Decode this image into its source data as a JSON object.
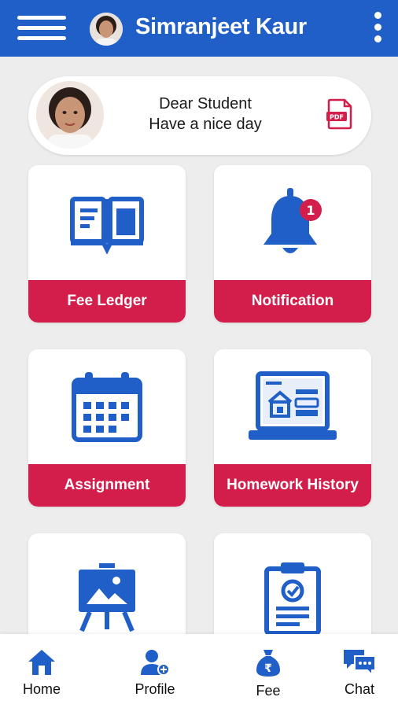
{
  "header": {
    "user_name": "Simranjeet Kaur",
    "menu_icon": "hamburger-menu-icon",
    "more_icon": "kebab-menu-icon"
  },
  "greeting": {
    "line1": "Dear Student",
    "line2": "Have a nice day",
    "pdf_label": "PDF"
  },
  "tiles": [
    {
      "label": "Fee Ledger",
      "icon": "book-icon"
    },
    {
      "label": "Notification",
      "icon": "bell-icon",
      "badge": "1"
    },
    {
      "label": "Assignment",
      "icon": "calendar-icon"
    },
    {
      "label": "Homework History",
      "icon": "laptop-icon"
    },
    {
      "label": "",
      "icon": "easel-icon"
    },
    {
      "label": "",
      "icon": "clipboard-icon"
    }
  ],
  "bottom_nav": [
    {
      "label": "Home",
      "icon": "home-icon"
    },
    {
      "label": "Profile",
      "icon": "profile-icon"
    },
    {
      "label": "Fee",
      "icon": "money-bag-icon",
      "symbol": "₹"
    },
    {
      "label": "Chat",
      "icon": "chat-icon"
    }
  ],
  "colors": {
    "primary_blue": "#1f5fc7",
    "accent_red": "#d31e4b",
    "background": "#ededed"
  }
}
